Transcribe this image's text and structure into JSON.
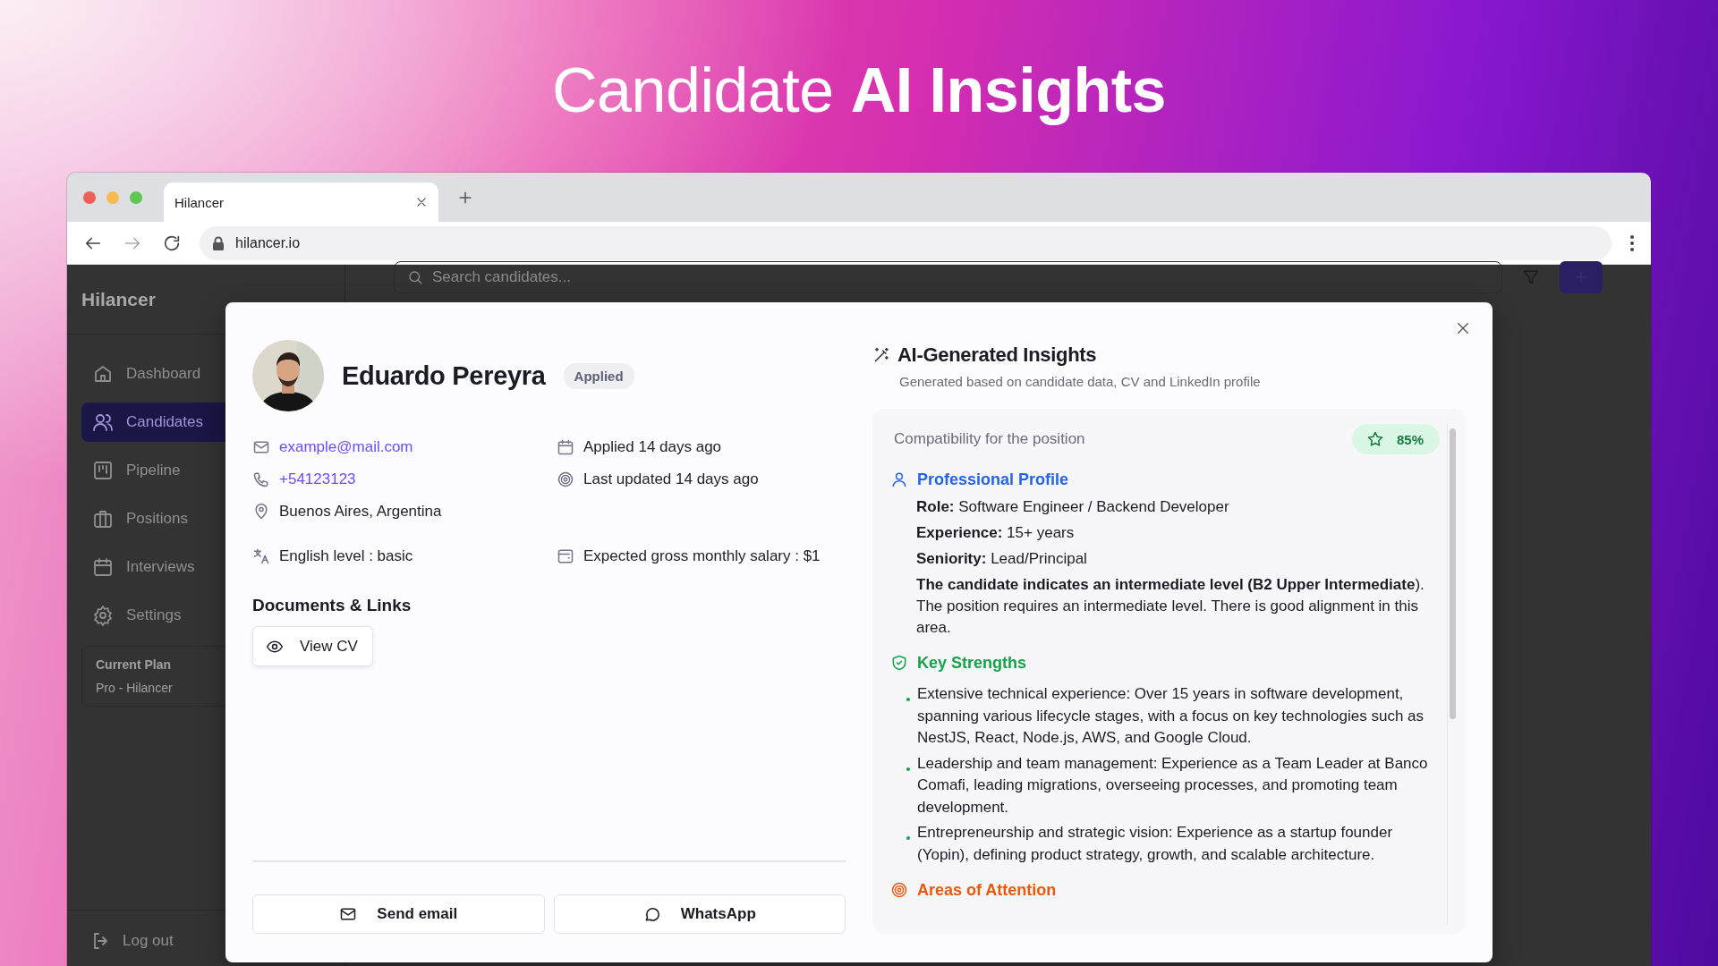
{
  "headline": "Candidate **AI Insights**",
  "browser": {
    "tab_title": "Hilancer",
    "url": "hilancer.io"
  },
  "app": {
    "brand": "Hilancer",
    "search": {
      "placeholder": "Search candidates..."
    },
    "nav": [
      {
        "label": "Dashboard",
        "selected": false
      },
      {
        "label": "Candidates",
        "selected": true
      },
      {
        "label": "Pipeline",
        "selected": false
      },
      {
        "label": "Positions",
        "selected": false
      },
      {
        "label": "Interviews",
        "selected": false
      },
      {
        "label": "Settings",
        "selected": false
      }
    ],
    "plan": {
      "label": "Current Plan",
      "value": "Pro - Hilancer"
    },
    "logout": "Log out"
  },
  "candidate": {
    "name": "Eduardo Pereyra",
    "status": "Applied",
    "detail_rows": [
      {
        "left": {
          "kind": "link",
          "text": "example@mail.com"
        },
        "right": {
          "kind": "text",
          "text": "Applied 14 days ago"
        }
      },
      {
        "left": {
          "kind": "link",
          "text": "+54123123"
        },
        "right": {
          "kind": "text",
          "text": "Last updated 14 days ago"
        }
      },
      {
        "left": {
          "kind": "text",
          "text": "Buenos Aires, Argentina"
        }
      },
      {
        "left": {
          "kind": "text",
          "text": "English level : basic"
        },
        "right": {
          "kind": "text",
          "text": "Expected gross monthly salary : $1"
        }
      }
    ],
    "documents_title": "Documents & Links",
    "view_cv": "View CV",
    "actions": [
      "Send email",
      "WhatsApp"
    ]
  },
  "insights": {
    "title": "AI-Generated Insights",
    "subtitle": "Generated based on candidate data, CV and LinkedIn profile",
    "compatibility": {
      "label": "Compatibility for the position",
      "score": "85%"
    },
    "sections": [
      {
        "kind": "fields",
        "title": "Professional Profile",
        "color": "#2563eb",
        "items": [
          "**Role:** Software Engineer / Backend Developer",
          "**Experience:** 15+ years",
          "**Seniority:** Lead/Principal",
          "**The candidate indicates an intermediate level (B2 Upper Intermediate**). The position requires an intermediate level. There is good alignment in this area."
        ]
      },
      {
        "kind": "bullets",
        "title": "Key Strengths",
        "color": "#16a34a",
        "items": [
          "Extensive technical experience: Over 15 years in software development, spanning various lifecycle stages, with a focus on key technologies such as NestJS, React, Node.js, AWS, and Google Cloud.",
          "Leadership and team management: Experience as a Team Leader at Banco Comafi, leading migrations, overseeing processes, and promoting team development.",
          "Entrepreneurship and strategic vision: Experience as a startup founder (Yopin), defining product strategy, growth, and scalable architecture."
        ]
      },
      {
        "title": "Areas of Attention",
        "color": "#ea580c"
      }
    ]
  }
}
